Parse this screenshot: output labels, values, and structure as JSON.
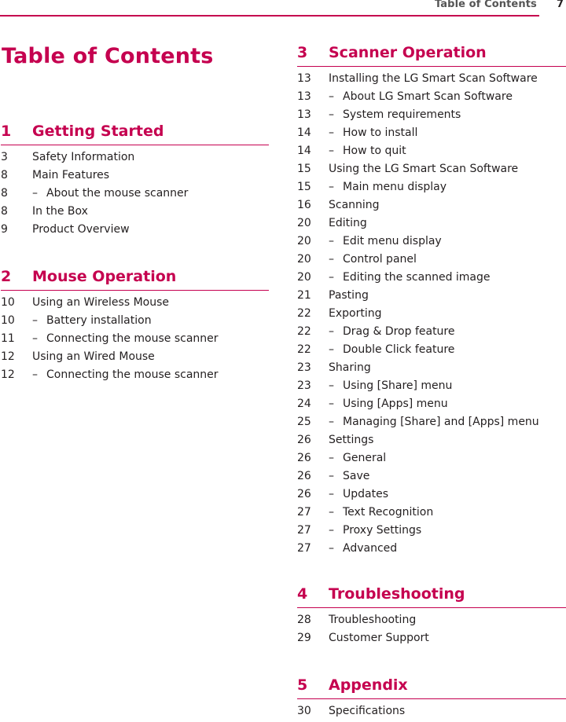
{
  "header": {
    "running_title": "Table of Contents",
    "page_number": "7"
  },
  "page_title": "Table of Contents",
  "accent_color": "#c5004f",
  "sections": [
    {
      "number": "1",
      "title": "Getting Started",
      "entries": [
        {
          "page": "3",
          "text": "Safety Information",
          "sub": false
        },
        {
          "page": "8",
          "text": "Main Features",
          "sub": false
        },
        {
          "page": "8",
          "text": "About the mouse scanner",
          "sub": true
        },
        {
          "page": "8",
          "text": "In the Box",
          "sub": false
        },
        {
          "page": "9",
          "text": "Product Overview",
          "sub": false
        }
      ]
    },
    {
      "number": "2",
      "title": "Mouse Operation",
      "entries": [
        {
          "page": "10",
          "text": "Using an Wireless Mouse",
          "sub": false
        },
        {
          "page": "10",
          "text": "Battery installation",
          "sub": true
        },
        {
          "page": "11",
          "text": "Connecting the mouse scanner",
          "sub": true
        },
        {
          "page": "12",
          "text": "Using an Wired Mouse",
          "sub": false
        },
        {
          "page": "12",
          "text": "Connecting the mouse scanner",
          "sub": true
        }
      ]
    },
    {
      "number": "3",
      "title": "Scanner Operation",
      "entries": [
        {
          "page": "13",
          "text": "Installing the LG Smart Scan Software",
          "sub": false
        },
        {
          "page": "13",
          "text": "About LG Smart Scan Software",
          "sub": true
        },
        {
          "page": "13",
          "text": "System requirements",
          "sub": true
        },
        {
          "page": "14",
          "text": "How to install",
          "sub": true
        },
        {
          "page": "14",
          "text": "How to quit",
          "sub": true
        },
        {
          "page": "15",
          "text": "Using the LG Smart Scan Software",
          "sub": false
        },
        {
          "page": "15",
          "text": "Main menu display",
          "sub": true
        },
        {
          "page": "16",
          "text": "Scanning",
          "sub": false
        },
        {
          "page": "20",
          "text": "Editing",
          "sub": false
        },
        {
          "page": "20",
          "text": "Edit menu display",
          "sub": true
        },
        {
          "page": "20",
          "text": "Control panel",
          "sub": true
        },
        {
          "page": "20",
          "text": "Editing the scanned image",
          "sub": true
        },
        {
          "page": "21",
          "text": "Pasting",
          "sub": false
        },
        {
          "page": "22",
          "text": "Exporting",
          "sub": false
        },
        {
          "page": "22",
          "text": "Drag & Drop feature",
          "sub": true
        },
        {
          "page": "22",
          "text": "Double Click feature",
          "sub": true
        },
        {
          "page": "23",
          "text": "Sharing",
          "sub": false
        },
        {
          "page": "23",
          "text": "Using [Share] menu",
          "sub": true
        },
        {
          "page": "24",
          "text": "Using [Apps] menu",
          "sub": true
        },
        {
          "page": "25",
          "text": "Managing [Share] and [Apps] menu",
          "sub": true
        },
        {
          "page": "26",
          "text": "Settings",
          "sub": false
        },
        {
          "page": "26",
          "text": "General",
          "sub": true
        },
        {
          "page": "26",
          "text": "Save",
          "sub": true
        },
        {
          "page": "26",
          "text": "Updates",
          "sub": true
        },
        {
          "page": "27",
          "text": "Text Recognition",
          "sub": true
        },
        {
          "page": "27",
          "text": "Proxy Settings",
          "sub": true
        },
        {
          "page": "27",
          "text": "Advanced",
          "sub": true
        }
      ]
    },
    {
      "number": "4",
      "title": "Troubleshooting",
      "entries": [
        {
          "page": "28",
          "text": "Troubleshooting",
          "sub": false
        },
        {
          "page": "29",
          "text": "Customer Support",
          "sub": false
        }
      ]
    },
    {
      "number": "5",
      "title": "Appendix",
      "entries": [
        {
          "page": "30",
          "text": "Specifications",
          "sub": false
        }
      ]
    }
  ],
  "sub_marker": "–"
}
